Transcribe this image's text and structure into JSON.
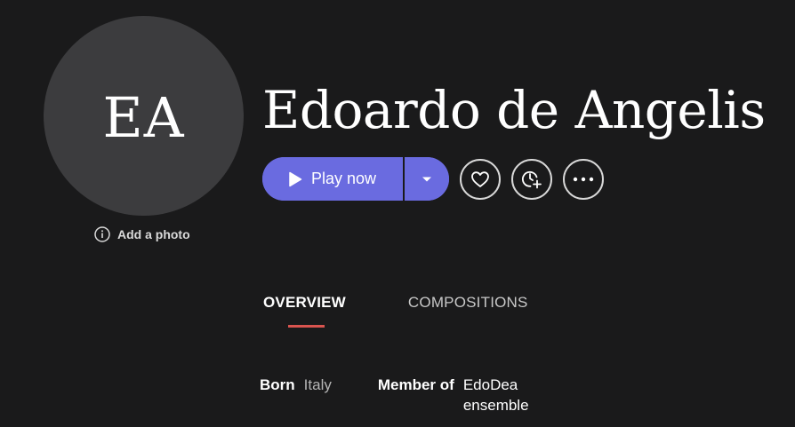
{
  "avatar": {
    "initials": "EA",
    "add_photo_label": "Add a photo"
  },
  "artist": {
    "name": "Edoardo de Angelis"
  },
  "actions": {
    "play_label": "Play now",
    "icons": [
      "play-icon",
      "caret-down-icon",
      "heart-icon",
      "clock-plus-icon",
      "more-icon"
    ],
    "accent_color": "#6a6be0"
  },
  "tabs": {
    "items": [
      {
        "label": "OVERVIEW",
        "active": true
      },
      {
        "label": "COMPOSITIONS",
        "active": false
      }
    ],
    "underline_color": "#d9544f"
  },
  "facts": {
    "born_label": "Born",
    "born_value": "Italy",
    "member_label": "Member of",
    "member_value": "EdoDea ensemble"
  }
}
